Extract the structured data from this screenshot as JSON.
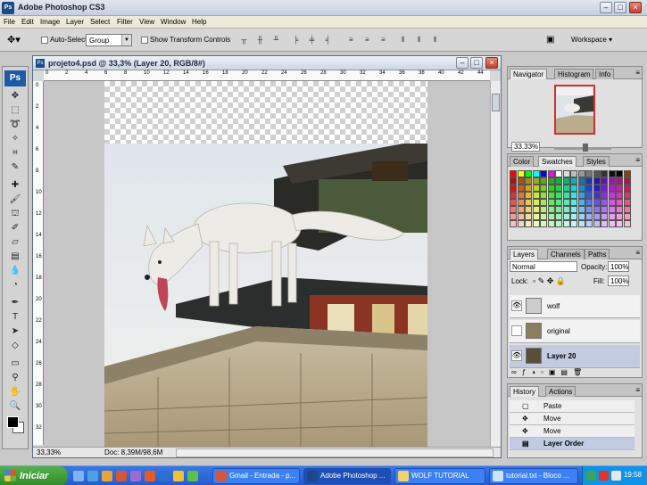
{
  "app": {
    "title": "Adobe Photoshop CS3",
    "logo": "Ps"
  },
  "menu": [
    "File",
    "Edit",
    "Image",
    "Layer",
    "Select",
    "Filter",
    "View",
    "Window",
    "Help"
  ],
  "options": {
    "auto_select_label": "Auto-Select:",
    "auto_select_value": "Group",
    "transform_label": "Show Transform Controls",
    "workspace_label": "Workspace ▾"
  },
  "document": {
    "title": "projeto4.psd @ 33,3% (Layer 20, RGB/8#)",
    "zoom": "33,33%",
    "doc_size": "Doc: 8,39M/98,6M",
    "ruler_h": [
      "0",
      "2",
      "4",
      "6",
      "8",
      "10",
      "12",
      "14",
      "16",
      "18",
      "20",
      "22",
      "24",
      "26",
      "28",
      "30",
      "32",
      "34",
      "36",
      "38",
      "40",
      "42",
      "44"
    ],
    "ruler_v": [
      "0",
      "2",
      "4",
      "6",
      "8",
      "10",
      "12",
      "14",
      "16",
      "18",
      "20",
      "22",
      "24",
      "26",
      "28",
      "30",
      "32"
    ]
  },
  "navigator": {
    "tabs": [
      "Navigator",
      "Histogram",
      "Info"
    ],
    "zoom": "33.33%"
  },
  "color_panel": {
    "tabs": [
      "Color",
      "Swatches",
      "Styles"
    ]
  },
  "layers_panel": {
    "tabs": [
      "Layers",
      "Channels",
      "Paths"
    ],
    "blend_mode": "Normal",
    "opacity_label": "Opacity:",
    "opacity_value": "100%",
    "lock_label": "Lock:",
    "fill_label": "Fill:",
    "fill_value": "100%",
    "layers": [
      {
        "name": "wolf",
        "visible": true,
        "selected": false
      },
      {
        "name": "original",
        "visible": false,
        "selected": false
      },
      {
        "name": "Layer 20",
        "visible": true,
        "selected": true
      }
    ]
  },
  "history_panel": {
    "tabs": [
      "History",
      "Actions"
    ],
    "items": [
      "Paste",
      "Move",
      "Move",
      "Layer Order"
    ]
  },
  "taskbar": {
    "start_label": "Iniciar",
    "tasks": [
      "Gmail - Entrada - p...",
      "Adobe Photoshop ...",
      "WOLF TUTORIAL",
      "tutorial.txt - Bloco ..."
    ],
    "clock": "19:58"
  }
}
